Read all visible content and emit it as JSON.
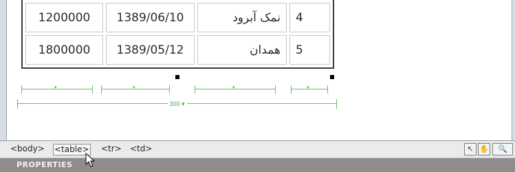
{
  "table": {
    "rows": [
      {
        "amount": "1200000",
        "date": "1389/06/10",
        "name": "نمک آبرود",
        "index": "4"
      },
      {
        "amount": "1800000",
        "date": "1389/05/12",
        "name": "همدان",
        "index": "5"
      }
    ]
  },
  "widths": {
    "total_label": "300 ▾",
    "column_arrow": "▾"
  },
  "tag_selector": {
    "tags": [
      "<body>",
      "<table>",
      "<tr>",
      "<td>"
    ],
    "selected": "<table>"
  },
  "tools": {
    "pointer": "↖",
    "hand": "✋",
    "zoom": "🔍"
  },
  "properties_panel": {
    "title": "PROPERTIES"
  },
  "colors": {
    "table_border": "#3b3b3b",
    "width_guide": "#6bb86b",
    "panel_header": "#8d8d8d"
  }
}
